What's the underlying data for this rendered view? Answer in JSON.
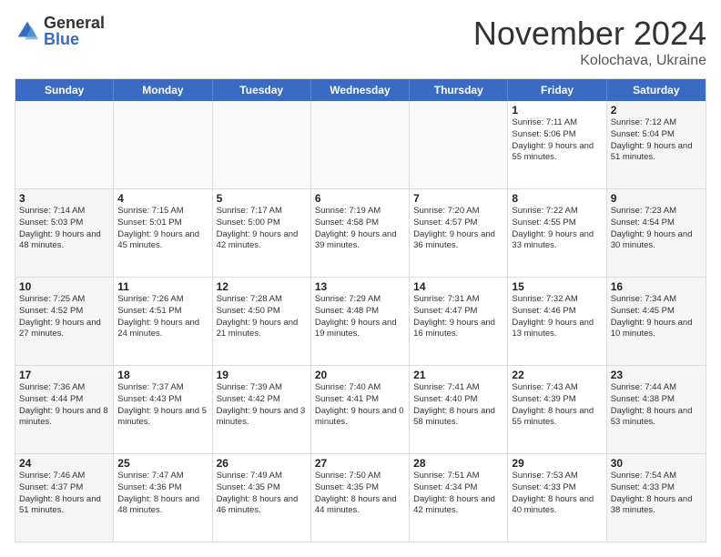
{
  "logo": {
    "general": "General",
    "blue": "Blue"
  },
  "title": "November 2024",
  "location": "Kolochava, Ukraine",
  "days": [
    "Sunday",
    "Monday",
    "Tuesday",
    "Wednesday",
    "Thursday",
    "Friday",
    "Saturday"
  ],
  "weeks": [
    [
      {
        "day": "",
        "info": ""
      },
      {
        "day": "",
        "info": ""
      },
      {
        "day": "",
        "info": ""
      },
      {
        "day": "",
        "info": ""
      },
      {
        "day": "",
        "info": ""
      },
      {
        "day": "1",
        "info": "Sunrise: 7:11 AM\nSunset: 5:06 PM\nDaylight: 9 hours and 55 minutes."
      },
      {
        "day": "2",
        "info": "Sunrise: 7:12 AM\nSunset: 5:04 PM\nDaylight: 9 hours and 51 minutes."
      }
    ],
    [
      {
        "day": "3",
        "info": "Sunrise: 7:14 AM\nSunset: 5:03 PM\nDaylight: 9 hours and 48 minutes."
      },
      {
        "day": "4",
        "info": "Sunrise: 7:15 AM\nSunset: 5:01 PM\nDaylight: 9 hours and 45 minutes."
      },
      {
        "day": "5",
        "info": "Sunrise: 7:17 AM\nSunset: 5:00 PM\nDaylight: 9 hours and 42 minutes."
      },
      {
        "day": "6",
        "info": "Sunrise: 7:19 AM\nSunset: 4:58 PM\nDaylight: 9 hours and 39 minutes."
      },
      {
        "day": "7",
        "info": "Sunrise: 7:20 AM\nSunset: 4:57 PM\nDaylight: 9 hours and 36 minutes."
      },
      {
        "day": "8",
        "info": "Sunrise: 7:22 AM\nSunset: 4:55 PM\nDaylight: 9 hours and 33 minutes."
      },
      {
        "day": "9",
        "info": "Sunrise: 7:23 AM\nSunset: 4:54 PM\nDaylight: 9 hours and 30 minutes."
      }
    ],
    [
      {
        "day": "10",
        "info": "Sunrise: 7:25 AM\nSunset: 4:52 PM\nDaylight: 9 hours and 27 minutes."
      },
      {
        "day": "11",
        "info": "Sunrise: 7:26 AM\nSunset: 4:51 PM\nDaylight: 9 hours and 24 minutes."
      },
      {
        "day": "12",
        "info": "Sunrise: 7:28 AM\nSunset: 4:50 PM\nDaylight: 9 hours and 21 minutes."
      },
      {
        "day": "13",
        "info": "Sunrise: 7:29 AM\nSunset: 4:48 PM\nDaylight: 9 hours and 19 minutes."
      },
      {
        "day": "14",
        "info": "Sunrise: 7:31 AM\nSunset: 4:47 PM\nDaylight: 9 hours and 16 minutes."
      },
      {
        "day": "15",
        "info": "Sunrise: 7:32 AM\nSunset: 4:46 PM\nDaylight: 9 hours and 13 minutes."
      },
      {
        "day": "16",
        "info": "Sunrise: 7:34 AM\nSunset: 4:45 PM\nDaylight: 9 hours and 10 minutes."
      }
    ],
    [
      {
        "day": "17",
        "info": "Sunrise: 7:36 AM\nSunset: 4:44 PM\nDaylight: 9 hours and 8 minutes."
      },
      {
        "day": "18",
        "info": "Sunrise: 7:37 AM\nSunset: 4:43 PM\nDaylight: 9 hours and 5 minutes."
      },
      {
        "day": "19",
        "info": "Sunrise: 7:39 AM\nSunset: 4:42 PM\nDaylight: 9 hours and 3 minutes."
      },
      {
        "day": "20",
        "info": "Sunrise: 7:40 AM\nSunset: 4:41 PM\nDaylight: 9 hours and 0 minutes."
      },
      {
        "day": "21",
        "info": "Sunrise: 7:41 AM\nSunset: 4:40 PM\nDaylight: 8 hours and 58 minutes."
      },
      {
        "day": "22",
        "info": "Sunrise: 7:43 AM\nSunset: 4:39 PM\nDaylight: 8 hours and 55 minutes."
      },
      {
        "day": "23",
        "info": "Sunrise: 7:44 AM\nSunset: 4:38 PM\nDaylight: 8 hours and 53 minutes."
      }
    ],
    [
      {
        "day": "24",
        "info": "Sunrise: 7:46 AM\nSunset: 4:37 PM\nDaylight: 8 hours and 51 minutes."
      },
      {
        "day": "25",
        "info": "Sunrise: 7:47 AM\nSunset: 4:36 PM\nDaylight: 8 hours and 48 minutes."
      },
      {
        "day": "26",
        "info": "Sunrise: 7:49 AM\nSunset: 4:35 PM\nDaylight: 8 hours and 46 minutes."
      },
      {
        "day": "27",
        "info": "Sunrise: 7:50 AM\nSunset: 4:35 PM\nDaylight: 8 hours and 44 minutes."
      },
      {
        "day": "28",
        "info": "Sunrise: 7:51 AM\nSunset: 4:34 PM\nDaylight: 8 hours and 42 minutes."
      },
      {
        "day": "29",
        "info": "Sunrise: 7:53 AM\nSunset: 4:33 PM\nDaylight: 8 hours and 40 minutes."
      },
      {
        "day": "30",
        "info": "Sunrise: 7:54 AM\nSunset: 4:33 PM\nDaylight: 8 hours and 38 minutes."
      }
    ]
  ]
}
